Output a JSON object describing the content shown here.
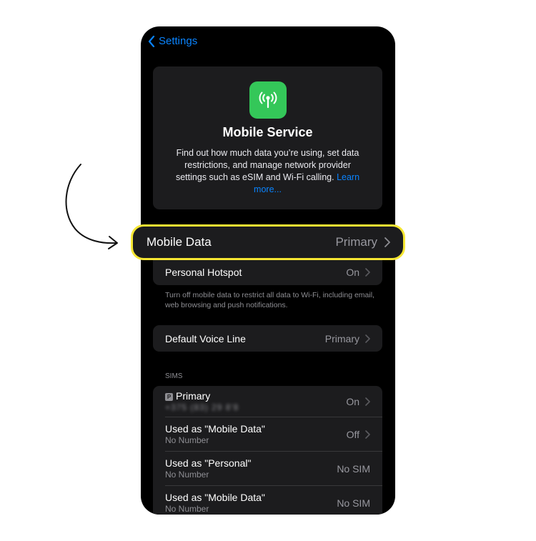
{
  "nav": {
    "back_label": "Settings"
  },
  "intro": {
    "icon": "antenna-signal-icon",
    "title": "Mobile Service",
    "description": "Find out how much data you’re using, set data restrictions, and manage network provider settings such as eSIM and Wi-Fi calling.",
    "link_label": "Learn more..."
  },
  "mobile_data": {
    "label": "Mobile Data",
    "value": "Primary"
  },
  "hotspot": {
    "label": "Personal Hotspot",
    "value": "On"
  },
  "footnote": "Turn off mobile data to restrict all data to Wi-Fi, including email, web browsing and push notifications.",
  "voice_line": {
    "label": "Default Voice Line",
    "value": "Primary"
  },
  "sims": {
    "header": "SIMS",
    "badge": "P",
    "items": [
      {
        "label": "Primary",
        "sub": "+375 (83) 29 8'8",
        "value": "On"
      },
      {
        "label": "Used as \"Mobile Data\"",
        "sub": "No Number",
        "value": "Off"
      },
      {
        "label": "Used as \"Personal\"",
        "sub": "No Number",
        "value": "No SIM"
      },
      {
        "label": "Used as \"Mobile Data\"",
        "sub": "No Number",
        "value": "No SIM"
      }
    ]
  },
  "colors": {
    "accent": "#0a84ff",
    "highlight": "#f5e632",
    "icon_green": "#34c759"
  }
}
